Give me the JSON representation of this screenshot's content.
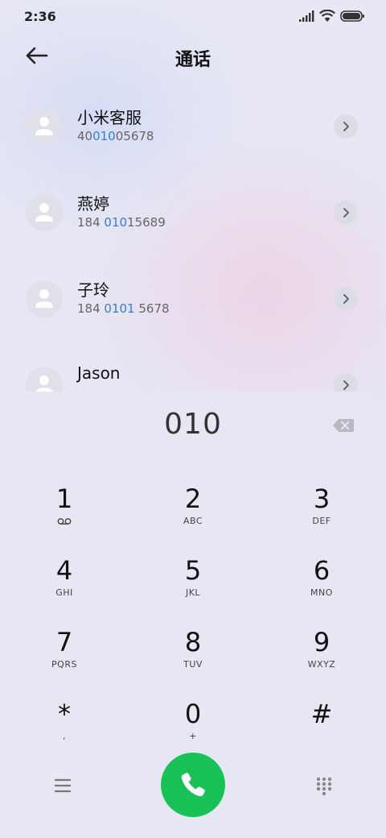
{
  "status_bar": {
    "time": "2:36",
    "icons": [
      "signal-icon",
      "wifi-icon",
      "battery-icon"
    ]
  },
  "header": {
    "title": "通话",
    "back_icon": "back-arrow-icon"
  },
  "contacts": [
    {
      "name": "小米客服",
      "number_pre": "40",
      "number_match": "010",
      "number_post": "05678"
    },
    {
      "name": "燕婷",
      "number_pre": "184 ",
      "number_match": "010",
      "number_post": "15689"
    },
    {
      "name": "子玲",
      "number_pre": "184 ",
      "number_match": "0101",
      "number_post": " 5678"
    },
    {
      "name": "Jason",
      "number_pre": "",
      "number_match": "",
      "number_post": ""
    }
  ],
  "dialpad": {
    "input_value": "010",
    "keys": [
      {
        "digit": "1",
        "letters": ""
      },
      {
        "digit": "2",
        "letters": "ABC"
      },
      {
        "digit": "3",
        "letters": "DEF"
      },
      {
        "digit": "4",
        "letters": "GHI"
      },
      {
        "digit": "5",
        "letters": "JKL"
      },
      {
        "digit": "6",
        "letters": "MNO"
      },
      {
        "digit": "7",
        "letters": "PQRS"
      },
      {
        "digit": "8",
        "letters": "TUV"
      },
      {
        "digit": "9",
        "letters": "WXYZ"
      },
      {
        "digit": "*",
        "letters": ","
      },
      {
        "digit": "0",
        "letters": "+"
      },
      {
        "digit": "#",
        "letters": ""
      }
    ]
  },
  "colors": {
    "accent_match": "#2f7fd6",
    "call_button": "#18c257",
    "panel_bg": "#e7e7f3"
  }
}
